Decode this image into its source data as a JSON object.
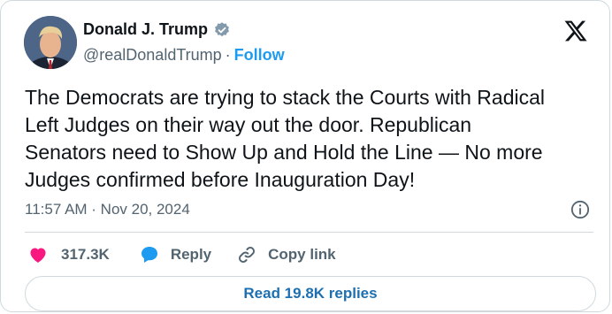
{
  "author": {
    "name": "Donald J. Trump",
    "handle": "@realDonaldTrump",
    "separator": "·",
    "follow_label": "Follow"
  },
  "tweet": {
    "text": "The Democrats are trying to stack the Courts with Radical\nLeft Judges on their way out the door. Republican\nSenators need to Show Up and Hold the Line — No more\nJudges confirmed before Inauguration Day!",
    "timestamp": "11:57 AM · Nov 20, 2024"
  },
  "actions": {
    "likes": "317.3K",
    "reply_label": "Reply",
    "copy_link_label": "Copy link"
  },
  "read_replies_label": "Read 19.8K replies",
  "colors": {
    "like": "#f91880",
    "reply": "#1d9bf0",
    "follow": "#1d9bf0",
    "verified": "#829aab"
  }
}
